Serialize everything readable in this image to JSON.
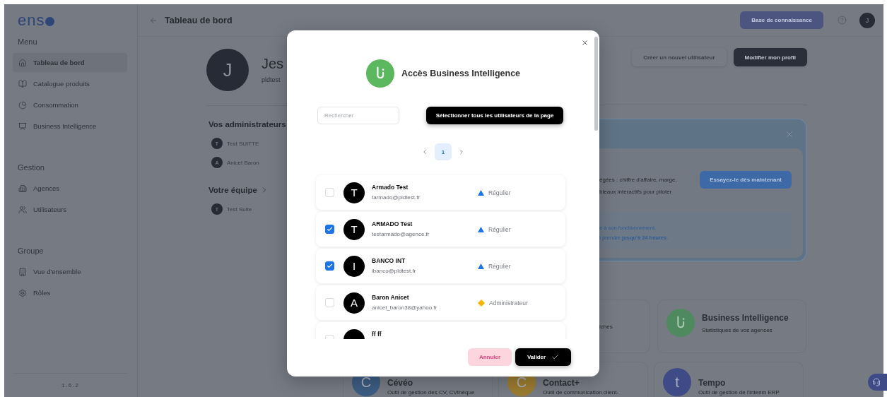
{
  "sidebar": {
    "logo": "ens",
    "sections": [
      {
        "title": "Menu",
        "items": [
          {
            "label": "Tableau de bord",
            "selected": true
          },
          {
            "label": "Catalogue produits",
            "selected": false
          },
          {
            "label": "Consommation",
            "selected": false
          },
          {
            "label": "Business Intelligence",
            "selected": false
          }
        ]
      },
      {
        "title": "Gestion",
        "items": [
          {
            "label": "Agences",
            "selected": false
          },
          {
            "label": "Utilisateurs",
            "selected": false
          }
        ]
      },
      {
        "title": "Groupe",
        "items": [
          {
            "label": "Vue d'ensemble",
            "selected": false
          },
          {
            "label": "Rôles",
            "selected": false
          }
        ]
      }
    ],
    "version": "1.6.2"
  },
  "header": {
    "title": "Tableau de bord",
    "knowledge_button": "Base de connaissance",
    "avatar": "J"
  },
  "profile": {
    "avatar": "J",
    "name": "Jes",
    "email": "pldtest",
    "admins_title": "Vos administrateurs",
    "admins": [
      {
        "initial": "T",
        "name": "Test SUITTE"
      },
      {
        "initial": "A",
        "name": "Anicet Baron"
      }
    ],
    "team_title": "Votre équipe",
    "team": [
      {
        "initial": "T",
        "name": "Test Suite"
      }
    ]
  },
  "profile_actions": [
    {
      "label": "Créer un nouvel utilisateur",
      "kind": "secondary"
    },
    {
      "label": "Modifier mon profil",
      "kind": "primary"
    }
  ],
  "banner": {
    "lines": [
      "égées : chiffre d'affaire, marge,",
      "bleaux interactifs pour piloter"
    ],
    "button": "Essayez-le dès maintenant",
    "info_lines": [
      "e à son fonctionnement.",
      "t prendre **jusqu'à 24 heures**."
    ]
  },
  "apps_row_1": [
    {
      "kind": "fragment",
      "description": "iches"
    },
    {
      "kind": "clip",
      "color": "#4f8a5e",
      "name": "Business Intelligence",
      "description": "Statistiques de vos agences"
    }
  ],
  "apps_row_2": [
    {
      "kind": "letter",
      "letter": "C",
      "color": "#3c5c82",
      "name": "Cévéo",
      "description": "Outil de gestion des CV, CVthèque"
    },
    {
      "kind": "letter",
      "letter": "C",
      "color": "#9b7b30",
      "name": "Contact+",
      "description": "Outil de communication client-"
    },
    {
      "kind": "letter",
      "letter": "t",
      "color": "#3f4b86",
      "name": "Tempo",
      "description": "Outil de gestion de l'interim ERP"
    }
  ],
  "modal": {
    "title": "Accès Business Intelligence",
    "search_placeholder": "Rechercher",
    "select_all": "Sélectionner tous les utilisateurs de la page",
    "pages": [
      {
        "label": "1",
        "selected": true
      }
    ],
    "users": [
      {
        "initial": "T",
        "name": "Armado Test",
        "email": "tarmado@pldtest.fr",
        "role": "Régulier",
        "kind": "regular",
        "checked": false
      },
      {
        "initial": "T",
        "name": "ARMADO Test",
        "email": "testarmado@agence.fr",
        "role": "Régulier",
        "kind": "regular",
        "checked": true
      },
      {
        "initial": "I",
        "name": "BANCO INT",
        "email": "ibanco@pldtest.fr",
        "role": "Régulier",
        "kind": "regular",
        "checked": true
      },
      {
        "initial": "A",
        "name": "Baron Anicet",
        "email": "anicet_baron38@yahoo.fr",
        "role": "Administrateur",
        "kind": "admin",
        "checked": false
      },
      {
        "name": "ff ff",
        "checked": false
      }
    ],
    "cancel": "Annuler",
    "confirm": "Valider"
  }
}
